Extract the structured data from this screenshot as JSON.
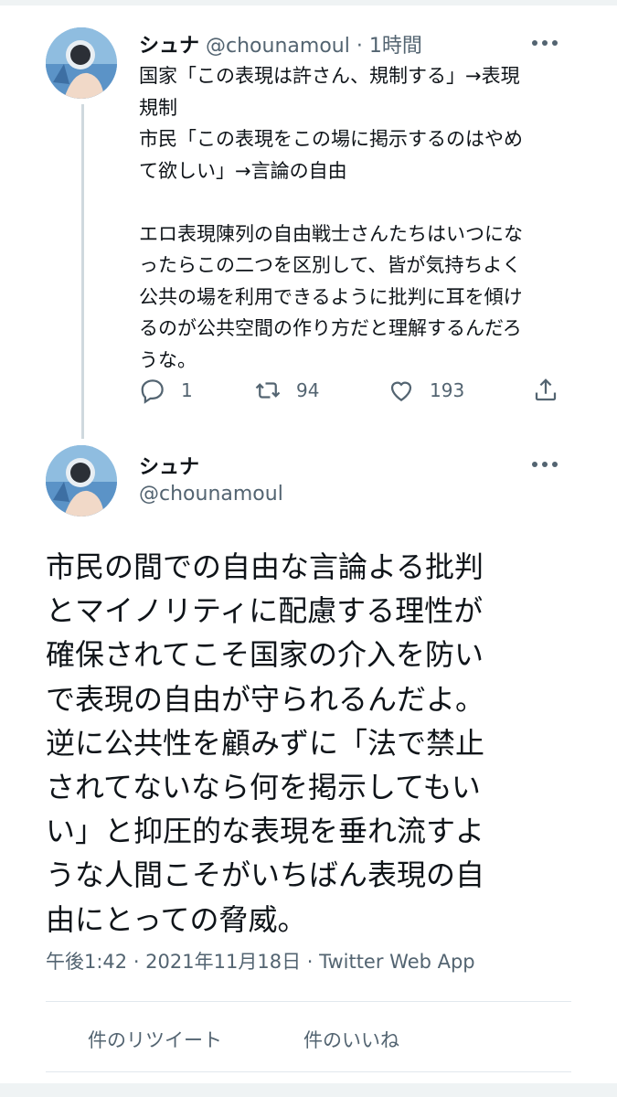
{
  "thread": {
    "tweet1": {
      "display_name": "シュナ",
      "handle": "@chounamoul",
      "separator": "·",
      "time": "1時間",
      "text_lines": [
        "国家「この表現は許さん、規制する」→表現",
        "規制",
        "市民「この表現をこの場に掲示するのはやめ",
        "て欲しい」→言論の自由",
        "",
        "エロ表現陳列の自由戦士さんたちはいつにな",
        "ったらこの二つを区別して、皆が気持ちよく",
        "公共の場を利用できるように批判に耳を傾け",
        "るのが公共空間の作り方だと理解するんだろ",
        "うな。"
      ],
      "actions": {
        "reply_count": "1",
        "retweet_count": "94",
        "like_count": "193"
      },
      "icons": [
        "avatar",
        "more-icon",
        "reply-icon",
        "retweet-icon",
        "like-icon",
        "share-icon"
      ]
    },
    "tweet2": {
      "display_name": "シュナ",
      "handle": "@chounamoul",
      "text_lines": [
        "市民の間での自由な言論よる批判",
        "とマイノリティに配慮する理性が",
        "確保されてこそ国家の介入を防い",
        "で表現の自由が守られるんだよ。",
        "逆に公共性を顧みずに「法で禁止",
        "されてないなら何を掲示してもい",
        "い」と抑圧的な表現を垂れ流すよ",
        "うな人間こそがいちばん表現の自",
        "由にとっての脅威。"
      ],
      "meta": "午後1:42 · 2021年11月18日 · Twitter Web App",
      "stats": {
        "retweets_link": "件のリツイート",
        "likes_link": "件のいいね"
      }
    }
  },
  "colors": {
    "text": "#0f1419",
    "muted": "#536471",
    "divider": "#e1e8ed",
    "thread_line": "#cfd9de"
  }
}
